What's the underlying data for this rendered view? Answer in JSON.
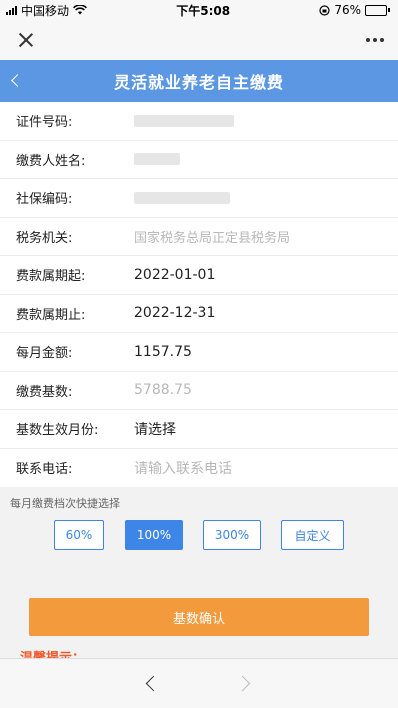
{
  "status": {
    "carrier": "中国移动",
    "time": "下午5:08",
    "battery": "76%",
    "battery_level": 0.76
  },
  "header": {
    "title": "灵活就业养老自主缴费"
  },
  "form": {
    "rows": [
      {
        "label": "证件号码:",
        "value": ""
      },
      {
        "label": "缴费人姓名:",
        "value": ""
      },
      {
        "label": "社保编码:",
        "value": ""
      },
      {
        "label": "税务机关:",
        "value": "国家税务总局正定县税务局"
      },
      {
        "label": "费款属期起:",
        "value": "2022-01-01"
      },
      {
        "label": "费款属期止:",
        "value": "2022-12-31"
      },
      {
        "label": "每月金额:",
        "value": "1157.75"
      },
      {
        "label": "缴费基数:",
        "value": "5788.75"
      },
      {
        "label": "基数生效月份:",
        "value": "请选择"
      },
      {
        "label": "联系电话:",
        "placeholder": "请输入联系电话"
      }
    ]
  },
  "quick": {
    "title": "每月缴费档次快捷选择",
    "options": [
      "60%",
      "100%",
      "300%",
      "自定义"
    ],
    "selected": "100%"
  },
  "confirm_label": "基数确认",
  "tip_title": "温馨提示："
}
